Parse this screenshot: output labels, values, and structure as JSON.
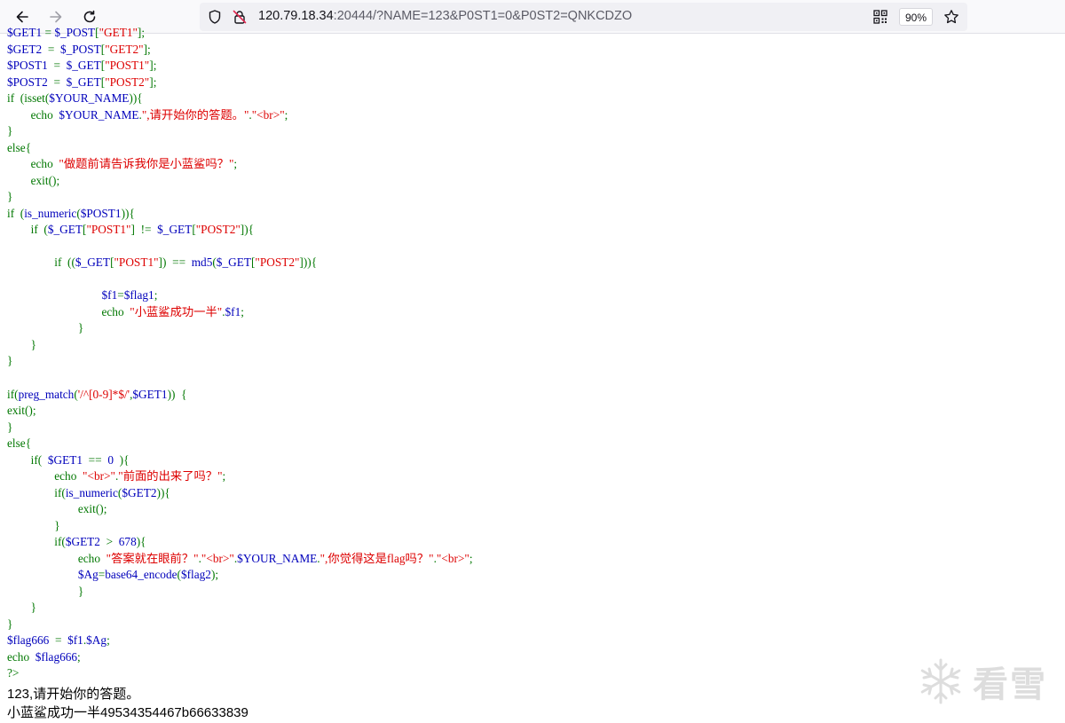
{
  "browser": {
    "url_host": "120.79.18.34",
    "url_rest": ":20444/?NAME=123&P0ST1=0&P0ST2=QNKCDZO",
    "zoom": "90%"
  },
  "code": {
    "line_0": "$GET1 = $_POST[\"GET1\"];",
    "line_1": "$GET2  =  $_POST[\"GET2\"];",
    "line_2": "$POST1  =  $_GET[\"POST1\"];",
    "line_3": "$POST2  =  $_GET[\"POST2\"];",
    "line_4": "if  (isset($YOUR_NAME)){",
    "line_5": "        echo  $YOUR_NAME.\",请开始你的答题。\".\"<br>\";",
    "line_6": "}",
    "line_7": "else{",
    "line_8": "        echo  \"做题前请告诉我你是小蓝鲨吗？\";",
    "line_9": "        exit();",
    "line_10": "}",
    "line_11": "if  (is_numeric($POST1)){",
    "line_12": "        if  ($_GET[\"POST1\"]  !=  $_GET[\"POST2\"]){",
    "line_13": "",
    "line_14": "                if  (($_GET[\"POST1\"])  ==  md5($_GET[\"POST2\"])){",
    "line_15": "",
    "line_16": "                                $f1=$flag1;",
    "line_17": "                                echo  \"小蓝鲨成功一半\".$f1;",
    "line_18": "                        }",
    "line_19": "        }",
    "line_20": "}",
    "line_21": "",
    "line_22": "if(preg_match('/^[0-9]*$/',$GET1))  {",
    "line_23": "exit();",
    "line_24": "}",
    "line_25": "else{",
    "line_26": "        if(  $GET1  ==  0  ){",
    "line_27": "                echo  \"<br>\".\"前面的出来了吗？\";",
    "line_28": "                if(is_numeric($GET2)){",
    "line_29": "                        exit();",
    "line_30": "                }",
    "line_31": "                if($GET2  >  678){",
    "line_32": "                        echo  \"答案就在眼前？\".\"<br>\".$YOUR_NAME.\",你觉得这是flag吗？\".\"<br>\";",
    "line_33": "                        $Ag=base64_encode($flag2);",
    "line_34": "                        }",
    "line_35": "        }",
    "line_36": "}",
    "line_37": "$flag666  =  $f1.$Ag;",
    "line_38": "echo  $flag666;",
    "line_39": "?>"
  },
  "output": {
    "line_1": "123,请开始你的答题。",
    "line_2": "小蓝鲨成功一半49534354467b66633839"
  },
  "watermark": {
    "text": "看雪"
  }
}
